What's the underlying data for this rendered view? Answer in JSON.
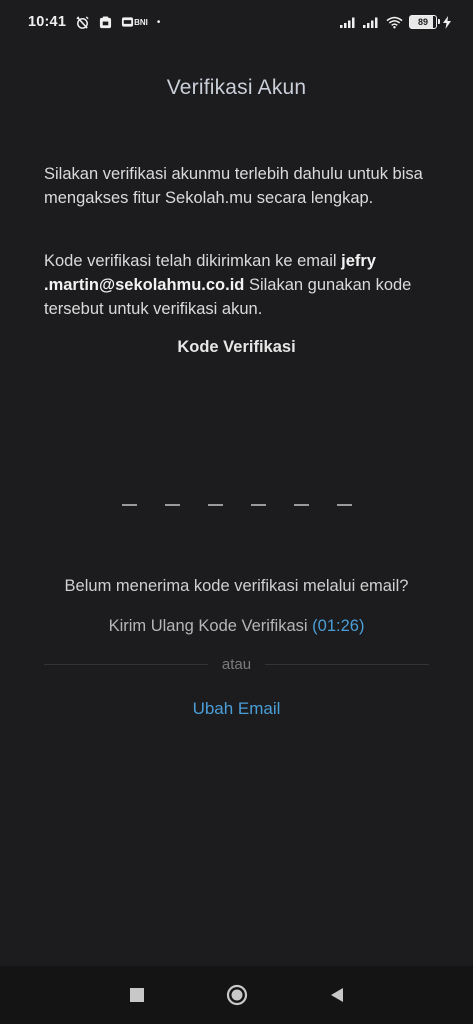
{
  "status_bar": {
    "time": "10:41",
    "bank_label": "BNI",
    "battery_level": "89",
    "icons": [
      "alarm-off-icon",
      "notification-icon",
      "bank-app-icon",
      "dot-icon",
      "signal-icon",
      "signal-icon",
      "wifi-icon",
      "battery-icon",
      "charging-icon"
    ]
  },
  "header": {
    "title": "Verifikasi Akun"
  },
  "content": {
    "intro": "Silakan verifikasi akunmu terlebih dahulu untuk bisa mengakses fitur Sekolah.mu secara lengkap.",
    "sent_prefix": "Kode verifikasi telah dikirimkan ke email ",
    "email": "jefry .martin@sekolahmu.co.id",
    "sent_suffix": " Silakan gunakan kode tersebut untuk verifikasi akun.",
    "code_label": "Kode Verifikasi"
  },
  "otp": {
    "length": 6
  },
  "resend": {
    "question": "Belum menerima kode verifikasi melalui email?",
    "label": "Kirim Ulang Kode Verifikasi",
    "timer": "(01:26)"
  },
  "divider": {
    "text": "atau"
  },
  "actions": {
    "change_email": "Ubah Email"
  },
  "nav": {
    "icons": [
      "recents-square-icon",
      "home-circle-icon",
      "back-triangle-icon"
    ]
  },
  "colors": {
    "background": "#1c1c1e",
    "accent": "#4a9ed8",
    "title": "#c9ced8",
    "navbar": "#141414"
  }
}
